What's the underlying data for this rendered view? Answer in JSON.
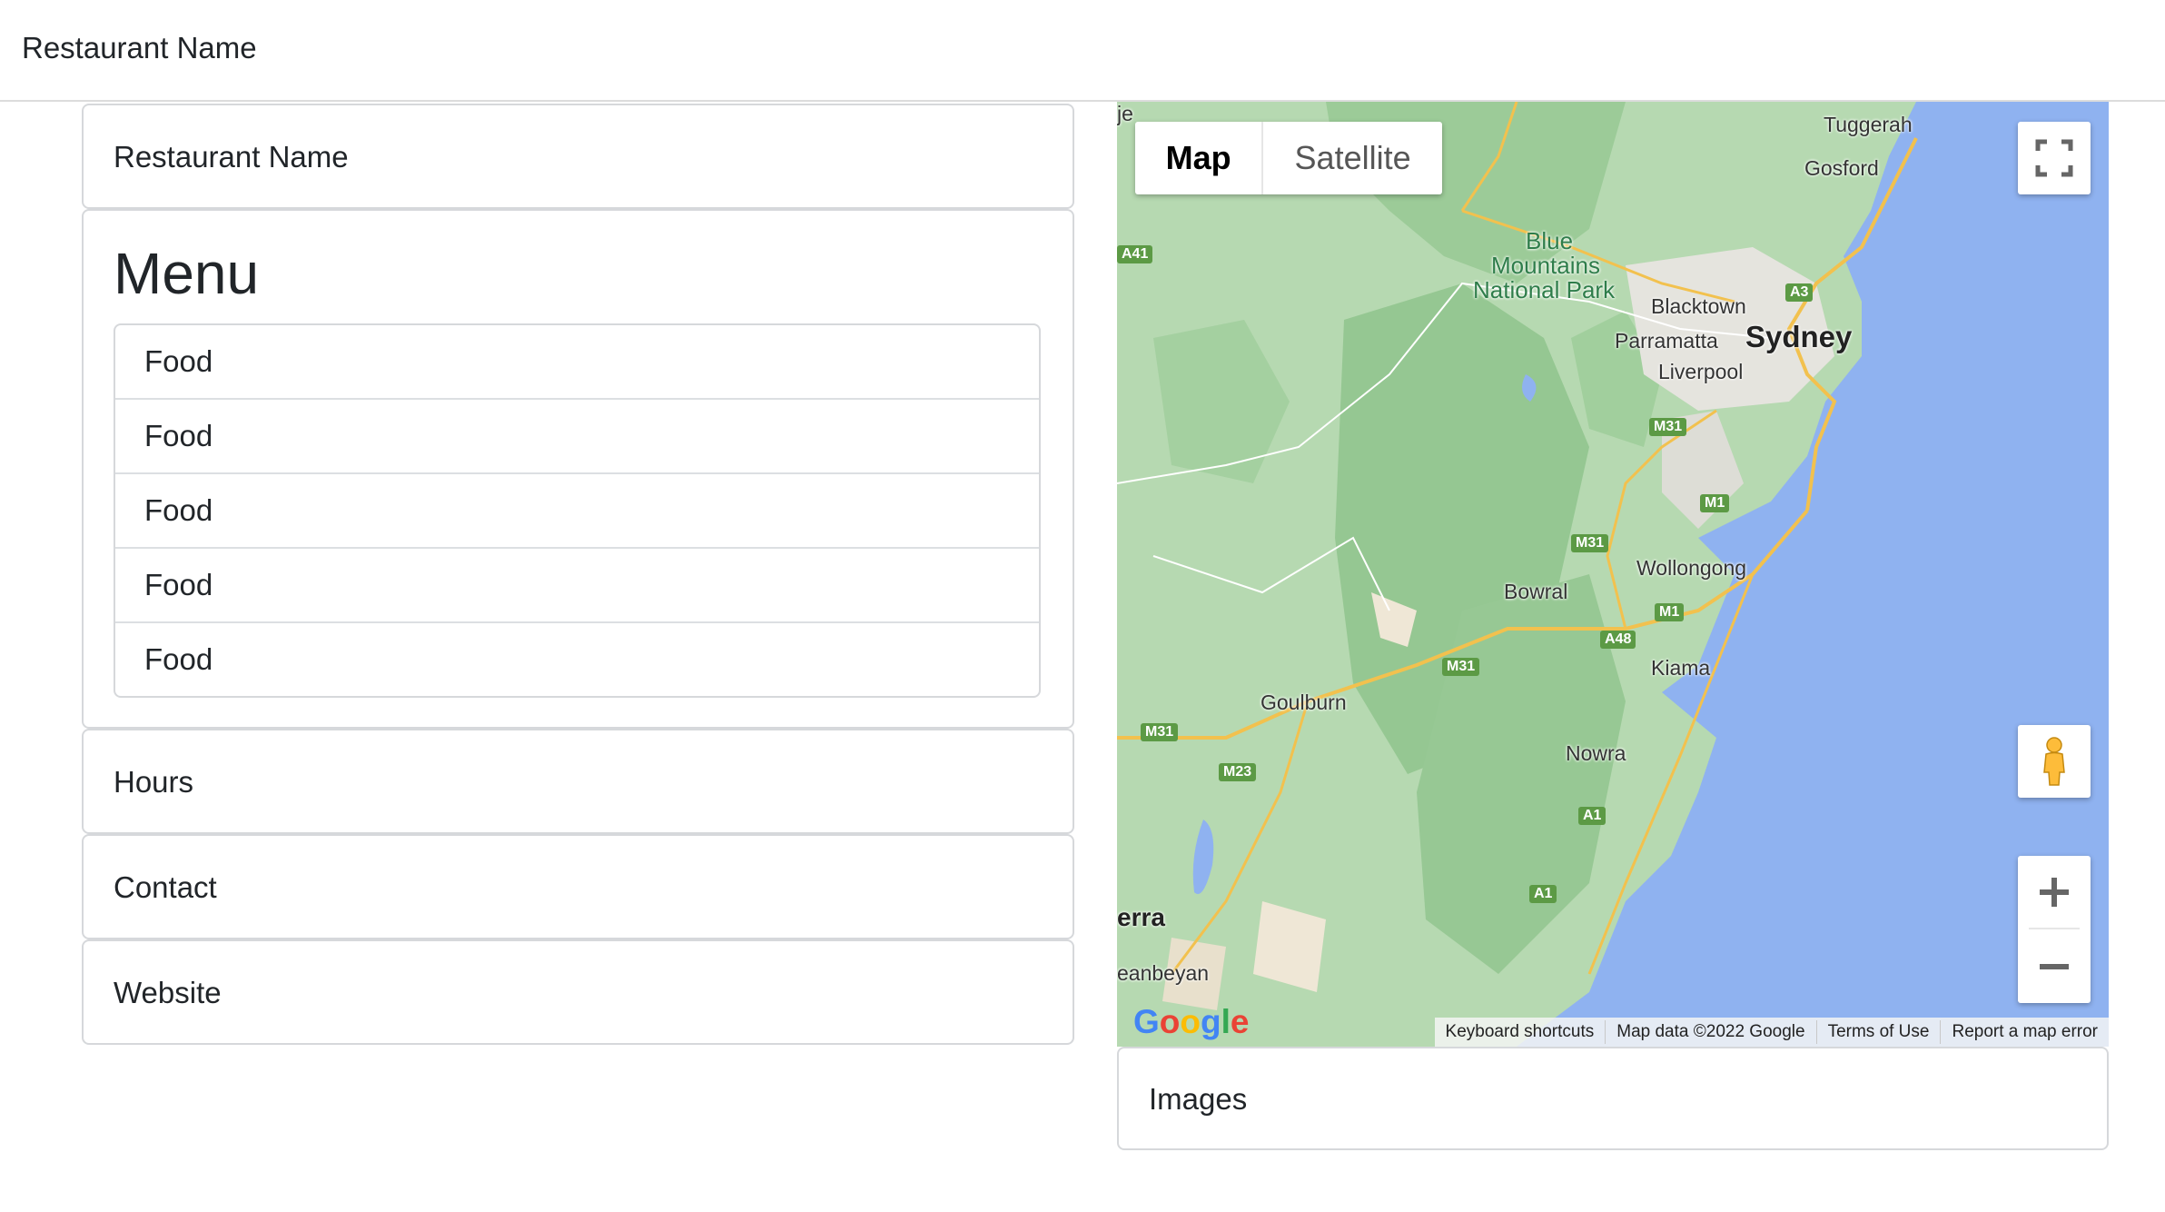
{
  "navbar": {
    "brand": "Restaurant Name"
  },
  "cards": {
    "name": "Restaurant Name",
    "menu_title": "Menu",
    "menu_items": [
      "Food",
      "Food",
      "Food",
      "Food",
      "Food"
    ],
    "hours": "Hours",
    "contact": "Contact",
    "website": "Website",
    "images": "Images"
  },
  "map": {
    "type_buttons": {
      "map": "Map",
      "satellite": "Satellite"
    },
    "icons": {
      "fullscreen": "fullscreen-icon",
      "pegman": "street-view-pegman-icon",
      "zoom_in": "plus-icon",
      "zoom_out": "minus-icon"
    },
    "logo": "Google",
    "footer": {
      "keyboard": "Keyboard shortcuts",
      "data": "Map data ©2022 Google",
      "terms": "Terms of Use",
      "report": "Report a map error"
    },
    "places": {
      "tuggerah": "Tuggerah",
      "gosford": "Gosford",
      "blue_mountains_1": "Blue",
      "blue_mountains_2": "Mountains",
      "blue_mountains_3": "National Park",
      "blacktown": "Blacktown",
      "parramatta": "Parramatta",
      "sydney": "Sydney",
      "liverpool": "Liverpool",
      "wollongong": "Wollongong",
      "bowral": "Bowral",
      "kiama": "Kiama",
      "goulburn": "Goulburn",
      "nowra": "Nowra",
      "canberra_partial": "erra",
      "queanbeyan_partial": "eanbeyan",
      "partial_top": "je"
    },
    "roads": {
      "a3": "A3",
      "m31_a": "M31",
      "m31_b": "M31",
      "m31_c": "M31",
      "m31_d": "M31",
      "m1_a": "M1",
      "m1_b": "M1",
      "a48": "A48",
      "m23": "M23",
      "a1_a": "A1",
      "a1_b": "A1",
      "a41": "A41"
    },
    "colors": {
      "land": "#b6d9b1",
      "forest": "#8fc48c",
      "ocean": "#8fb2f0",
      "urban": "#e8e6e0",
      "road": "#f2c14e"
    }
  }
}
